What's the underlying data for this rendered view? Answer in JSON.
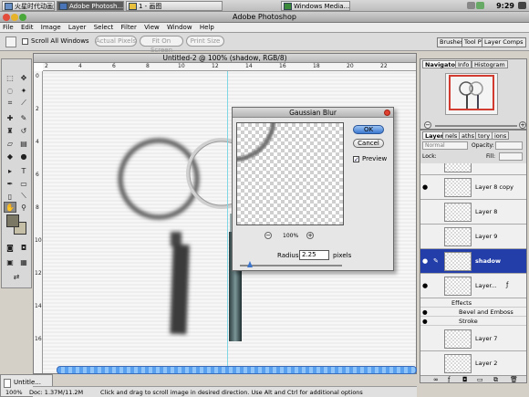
{
  "taskbar": {
    "items": [
      {
        "label": "火星时代动画大..."
      },
      {
        "label": "Adobe Photosh..."
      },
      {
        "label": "1 - 画图"
      },
      {
        "label": "Windows Media..."
      }
    ],
    "clock": "9:29"
  },
  "app": {
    "title": "Adobe Photoshop"
  },
  "menu": [
    "File",
    "Edit",
    "Image",
    "Layer",
    "Select",
    "Filter",
    "View",
    "Window",
    "Help"
  ],
  "options": {
    "scroll_all": "Scroll All Windows",
    "actual_pixels": "Actual Pixels",
    "fit_on_screen": "Fit On Screen",
    "print_size": "Print Size",
    "well_tabs": [
      "Brushes",
      "Tool Pr",
      "Layer Comps"
    ]
  },
  "document": {
    "title": "Untitled-2 @ 100% (shadow, RGB/8)",
    "ruler_h": [
      "2",
      "4",
      "6",
      "8",
      "10",
      "12",
      "14",
      "16",
      "18",
      "20",
      "22"
    ],
    "ruler_v": [
      "0",
      "2",
      "4",
      "6",
      "8",
      "10",
      "12",
      "14",
      "16"
    ]
  },
  "dialog": {
    "title": "Gaussian Blur",
    "ok": "OK",
    "cancel": "Cancel",
    "preview": "Preview",
    "zoom": "100%",
    "radius_label": "Radius:",
    "radius_value": "2.25",
    "radius_unit": "pixels"
  },
  "navigator": {
    "tabs": [
      "Navigator",
      "Info",
      "Histogram"
    ]
  },
  "layers": {
    "tabs": [
      "Layers",
      "nels",
      "aths",
      "tory",
      "ions"
    ],
    "blend_mode": "Normal",
    "opacity_label": "Opacity:",
    "lock_label": "Lock:",
    "fill_label": "Fill:",
    "rows": [
      {
        "name": "Layer 8 copy"
      },
      {
        "name": "Layer 8"
      },
      {
        "name": "Layer 9"
      },
      {
        "name": "shadow"
      },
      {
        "name": "Layer..."
      }
    ],
    "effects": [
      "Effects",
      "Bevel and Emboss",
      "Stroke"
    ],
    "rows_after": [
      {
        "name": "Layer 7"
      },
      {
        "name": "Layer 2"
      }
    ]
  },
  "status": {
    "minimized_doc": "Untitle...",
    "zoom": "100%",
    "doc_size": "Doc: 1.37M/11.2M",
    "hint": "Click and drag to scroll image in desired direction.  Use Alt and Ctrl for additional options"
  }
}
